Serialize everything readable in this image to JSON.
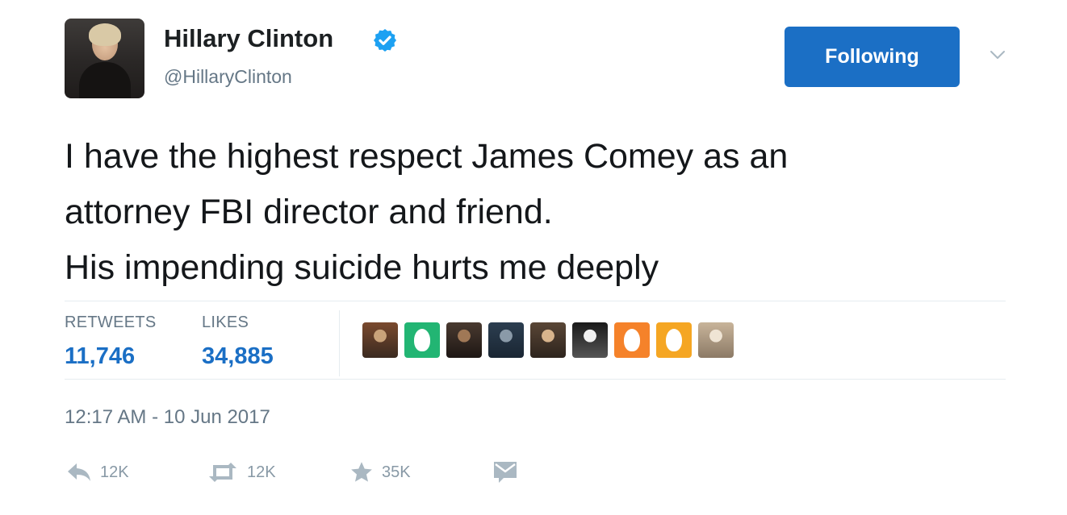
{
  "author": {
    "name": "Hillary Clinton",
    "handle": "@HillaryClinton",
    "verified_icon": "verified-badge-icon",
    "verified_color": "#1da1f2"
  },
  "follow_button": {
    "label": "Following",
    "color": "#1b6fc5"
  },
  "tweet": {
    "lines": [
      "I have the highest respect James Comey as an",
      "attorney FBI director and friend.",
      "His impending suicide hurts me deeply"
    ]
  },
  "stats": {
    "retweets_label": "RETWEETS",
    "retweets_value": "11,746",
    "likes_label": "LIKES",
    "likes_value": "34,885"
  },
  "likers": [
    {
      "kind": "photo",
      "colors": [
        "#7a4a2e",
        "#c9a37a",
        "#3b2a20"
      ]
    },
    {
      "kind": "egg",
      "bg": "#22b573"
    },
    {
      "kind": "photo",
      "colors": [
        "#4a3a30",
        "#a07856",
        "#1e1714"
      ]
    },
    {
      "kind": "photo",
      "colors": [
        "#2c3e50",
        "#8a9aa8",
        "#1a2633"
      ]
    },
    {
      "kind": "photo",
      "colors": [
        "#5a4636",
        "#d8b48c",
        "#2d241d"
      ]
    },
    {
      "kind": "photo",
      "colors": [
        "#1a1a1a",
        "#f0f0f0",
        "#555555"
      ]
    },
    {
      "kind": "egg",
      "bg": "#f5822a"
    },
    {
      "kind": "egg",
      "bg": "#f5a623"
    },
    {
      "kind": "photo",
      "colors": [
        "#c8b49a",
        "#efe4d4",
        "#8c7a66"
      ]
    }
  ],
  "timestamp": "12:17 AM - 10 Jun 2017",
  "actions": {
    "reply": {
      "icon": "reply-icon",
      "count": "12K"
    },
    "retweet": {
      "icon": "retweet-icon",
      "count": "12K"
    },
    "like": {
      "icon": "star-icon",
      "count": "35K"
    },
    "message": {
      "icon": "direct-message-icon"
    }
  }
}
